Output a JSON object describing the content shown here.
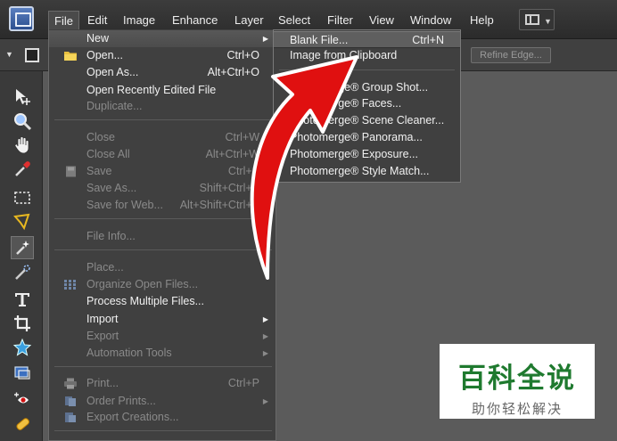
{
  "menubar": {
    "items": [
      "File",
      "Edit",
      "Image",
      "Enhance",
      "Layer",
      "Select",
      "Filter",
      "View",
      "Window",
      "Help"
    ]
  },
  "options_bar": {
    "refine_edge": "Refine Edge..."
  },
  "file_menu": {
    "new": "New",
    "open": "Open...",
    "open_sc": "Ctrl+O",
    "open_as": "Open As...",
    "open_as_sc": "Alt+Ctrl+O",
    "open_recent": "Open Recently Edited File",
    "duplicate": "Duplicate...",
    "close": "Close",
    "close_sc": "Ctrl+W",
    "close_all": "Close All",
    "close_all_sc": "Alt+Ctrl+W",
    "save": "Save",
    "save_sc": "Ctrl+S",
    "save_as": "Save As...",
    "save_as_sc": "Shift+Ctrl+S",
    "save_web": "Save for Web...",
    "save_web_sc": "Alt+Shift+Ctrl+S",
    "file_info": "File Info...",
    "place": "Place...",
    "organize": "Organize Open Files...",
    "process": "Process Multiple Files...",
    "import": "Import",
    "export": "Export",
    "automation": "Automation Tools",
    "print": "Print...",
    "print_sc": "Ctrl+P",
    "order_prints": "Order Prints...",
    "export_creations": "Export Creations..."
  },
  "new_submenu": {
    "blank": "Blank File...",
    "blank_sc": "Ctrl+N",
    "clipboard": "Image from Clipboard",
    "group_shot": "Photomerge® Group Shot...",
    "faces": "Photomerge® Faces...",
    "scene_cleaner": "Photomerge® Scene Cleaner...",
    "panorama": "Photomerge® Panorama...",
    "exposure": "Photomerge® Exposure...",
    "style_match": "Photomerge® Style Match..."
  },
  "watermark": {
    "title": "百科全说",
    "subtitle": "助你轻松解决"
  },
  "colors": {
    "arrow": "#e01010",
    "watermark_green": "#1f7a2f"
  }
}
